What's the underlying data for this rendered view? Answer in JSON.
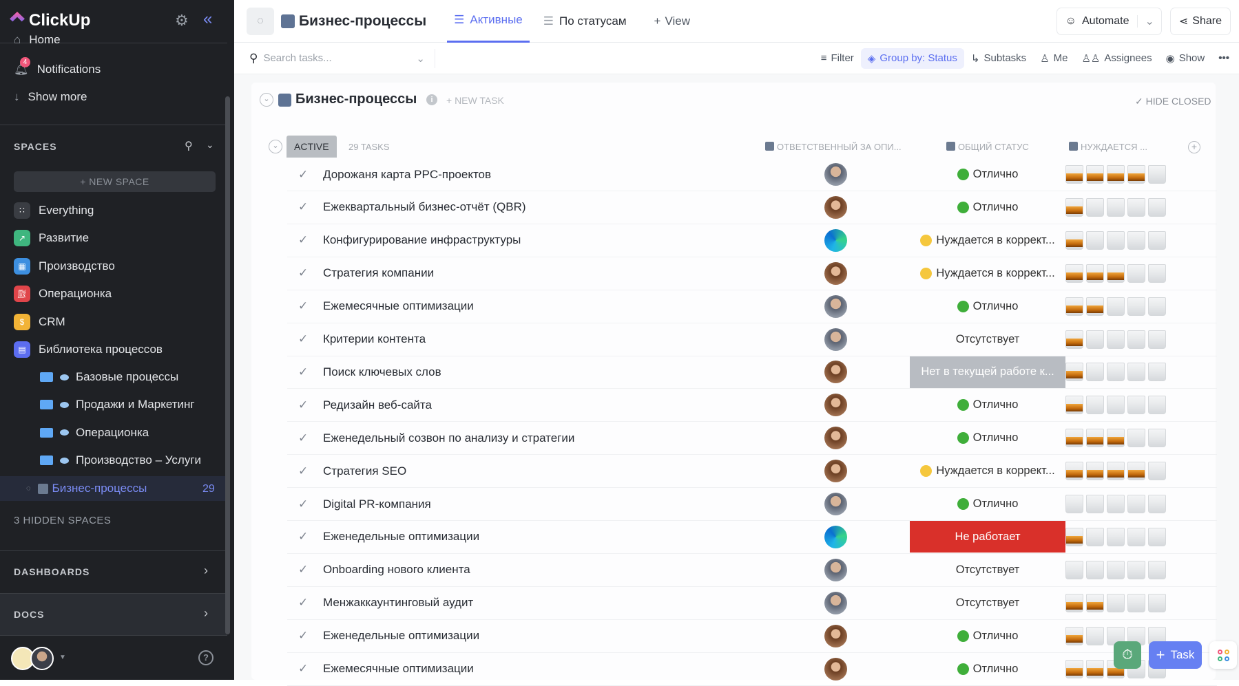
{
  "app": {
    "name": "ClickUp"
  },
  "sidebar": {
    "home": "Home",
    "notifications": "Notifications",
    "notif_count": "4",
    "show_more": "Show more",
    "spaces_title": "SPACES",
    "new_space": "+ NEW SPACE",
    "spaces": [
      {
        "label": "Everything",
        "color": "#3a3d43",
        "icon": "grid-icon"
      },
      {
        "label": "Развитие",
        "color": "#3fb67f",
        "icon": "chart-icon"
      },
      {
        "label": "Производство",
        "color": "#3d8fe0",
        "icon": "factory-icon"
      },
      {
        "label": "Операционка",
        "color": "#e0454a",
        "icon": "fuel-icon"
      },
      {
        "label": "CRM",
        "color": "#f2b336",
        "icon": "card-icon"
      },
      {
        "label": "Библиотека процессов",
        "color": "#5c6df0",
        "icon": "book-icon"
      }
    ],
    "folders": [
      "Базовые процессы",
      "Продажи и Маркетинг",
      "Операционка",
      "Производство – Услуги"
    ],
    "active_list": {
      "label": "Бизнес-процессы",
      "count": "29"
    },
    "hidden_spaces": "3 HIDDEN SPACES",
    "dashboards": "DASHBOARDS",
    "docs": "DOCS"
  },
  "header": {
    "title": "Бизнес-процессы",
    "tabs": [
      {
        "label": "Активные"
      },
      {
        "label": "По статусам"
      }
    ],
    "add_view": "View",
    "automate": "Automate",
    "share": "Share"
  },
  "toolbar": {
    "search_placeholder": "Search tasks...",
    "filter": "Filter",
    "group_by": "Group by: Status",
    "subtasks": "Subtasks",
    "me": "Me",
    "assignees": "Assignees",
    "show": "Show"
  },
  "list": {
    "title": "Бизнес-процессы",
    "new_task": "+ NEW TASK",
    "hide_closed": "HIDE CLOSED",
    "group": "ACTIVE",
    "task_count": "29 TASKS",
    "columns": [
      "ОТВЕТСТВЕННЫЙ ЗА ОПИ...",
      "ОБЩИЙ СТАТУС",
      "НУЖДАЕТСЯ ..."
    ]
  },
  "colors": {
    "green": "#3fae3a",
    "yellow": "#f5c73d",
    "red": "#d9302a",
    "gray": "#b8bcc2",
    "accent": "#5b6ef0"
  },
  "tasks": [
    {
      "name": "Дорожаня карта PPC-проектов",
      "status": "Отлично",
      "kind": "green",
      "rating": 4,
      "avatar": "man"
    },
    {
      "name": "Ежеквартальный бизнес-отчёт (QBR)",
      "status": "Отлично",
      "kind": "green",
      "rating": 1,
      "avatar": "woman"
    },
    {
      "name": "Конфигурирование инфраструктуры",
      "status": "Нуждается в коррект...",
      "kind": "yellow",
      "rating": 1,
      "avatar": "edge"
    },
    {
      "name": "Стратегия компании",
      "status": "Нуждается в коррект...",
      "kind": "yellow",
      "rating": 3,
      "avatar": "woman"
    },
    {
      "name": "Ежемесячные оптимизации",
      "status": "Отлично",
      "kind": "green",
      "rating": 2,
      "avatar": "man"
    },
    {
      "name": "Критерии контента",
      "status": "Отсутствует",
      "kind": "none",
      "rating": 1,
      "avatar": "man"
    },
    {
      "name": "Поиск ключевых слов",
      "status": "Нет в текущей работе к...",
      "kind": "gray",
      "rating": 1,
      "avatar": "woman"
    },
    {
      "name": "Редизайн веб-сайта",
      "status": "Отлично",
      "kind": "green",
      "rating": 1,
      "avatar": "woman"
    },
    {
      "name": "Еженедельный созвон по анализу и стратегии",
      "status": "Отлично",
      "kind": "green",
      "rating": 3,
      "avatar": "woman"
    },
    {
      "name": "Стратегия SEO",
      "status": "Нуждается в коррект...",
      "kind": "yellow",
      "rating": 4,
      "avatar": "woman"
    },
    {
      "name": "Digital PR-компания",
      "status": "Отлично",
      "kind": "green",
      "rating": 0,
      "avatar": "man"
    },
    {
      "name": "Еженедельные оптимизации",
      "status": "Не работает",
      "kind": "red",
      "rating": 1,
      "avatar": "edge"
    },
    {
      "name": "Onboarding нового клиента",
      "status": "Отсутствует",
      "kind": "none",
      "rating": 0,
      "avatar": "man"
    },
    {
      "name": "Менжаккаунтинговый аудит",
      "status": "Отсутствует",
      "kind": "none",
      "rating": 2,
      "avatar": "man"
    },
    {
      "name": "Еженедельные оптимизации",
      "status": "Отлично",
      "kind": "green",
      "rating": 1,
      "avatar": "woman"
    },
    {
      "name": "Ежемесячные оптимизации",
      "status": "Отлично",
      "kind": "green",
      "rating": 3,
      "avatar": "woman"
    }
  ],
  "fab": {
    "task": "Task"
  }
}
